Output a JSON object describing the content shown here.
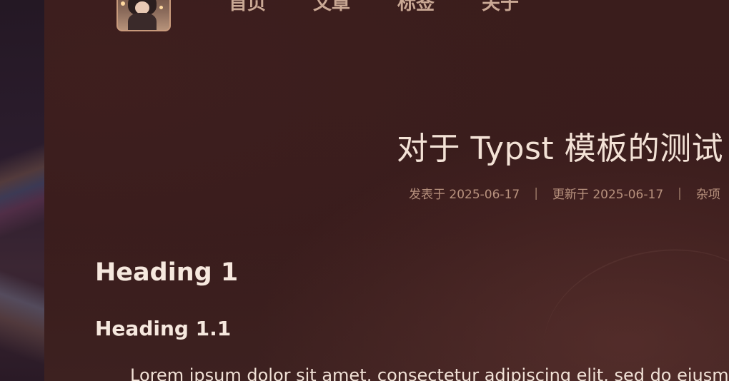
{
  "nav": {
    "items": [
      {
        "label": "首页"
      },
      {
        "label": "文章"
      },
      {
        "label": "标签"
      },
      {
        "label": "关于"
      }
    ]
  },
  "post": {
    "title": "对于 Typst 模板的测试",
    "published": "发表于 2025-06-17",
    "updated": "更新于 2025-06-17",
    "separator": "|",
    "category": "杂项"
  },
  "content": {
    "heading1": "Heading 1",
    "heading1_1": "Heading 1.1",
    "paragraph": "Lorem ipsum dolor sit amet, consectetur adipiscing elit, sed do eiusmod tem"
  },
  "colors": {
    "background": "#391c1c",
    "nav_text": "#c9a894",
    "title_text": "#f3e2d6",
    "meta_text": "#b8927e",
    "avatar_border": "#c89a7c"
  }
}
